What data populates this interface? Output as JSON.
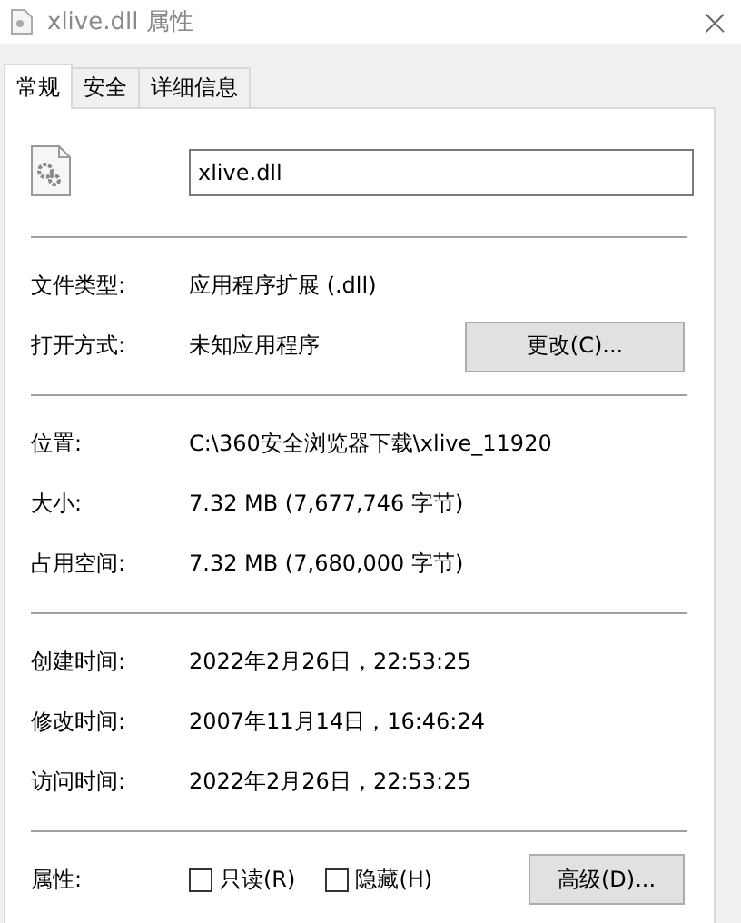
{
  "window": {
    "title": "xlive.dll 属性",
    "close": "×"
  },
  "tabs": [
    {
      "label": "常规",
      "selected": true
    },
    {
      "label": "安全",
      "selected": false
    },
    {
      "label": "详细信息",
      "selected": false
    }
  ],
  "file_name": "xlive.dll",
  "groups": [
    {
      "rows": [
        {
          "label": "文件类型:",
          "value": "应用程序扩展 (.dll)"
        },
        {
          "label": "打开方式:",
          "value": "未知应用程序",
          "button": "更改(C)..."
        }
      ]
    },
    {
      "rows": [
        {
          "label": "位置:",
          "value": "C:\\360安全浏览器下载\\xlive_11920"
        },
        {
          "label": "大小:",
          "value": "7.32 MB (7,677,746 字节)"
        },
        {
          "label": "占用空间:",
          "value": "7.32 MB (7,680,000 字节)"
        }
      ]
    },
    {
      "rows": [
        {
          "label": "创建时间:",
          "value": "2022年2月26日，22:53:25"
        },
        {
          "label": "修改时间:",
          "value": "2007年11月14日，16:46:24"
        },
        {
          "label": "访问时间:",
          "value": "2022年2月26日，22:53:25"
        }
      ]
    }
  ],
  "attributes": {
    "label": "属性:",
    "checkboxes": [
      {
        "label": "只读(R)",
        "checked": false
      },
      {
        "label": "隐藏(H)",
        "checked": false
      }
    ],
    "button": "高级(D)..."
  }
}
